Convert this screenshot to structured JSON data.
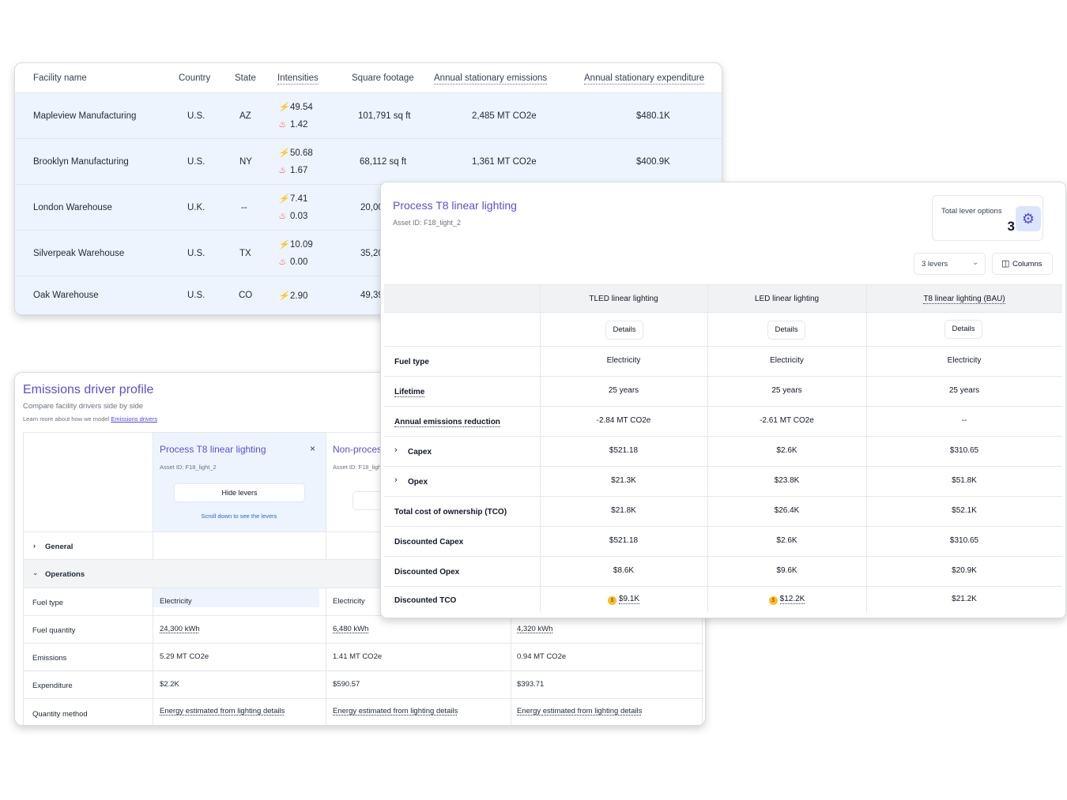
{
  "facility_table": {
    "headers": {
      "facility_name": "Facility name",
      "country": "Country",
      "state": "State",
      "intensities": "Intensities",
      "square_footage": "Square footage",
      "annual_emissions": "Annual stationary emissions",
      "annual_expenditure": "Annual stationary expenditure"
    },
    "rows": [
      {
        "name": "Mapleview Manufacturing",
        "country": "U.S.",
        "state": "AZ",
        "electric": "49.54",
        "fuel": "1.42",
        "sqft": "101,791 sq ft",
        "emissions": "2,485 MT CO2e",
        "expenditure": "$480.1K"
      },
      {
        "name": "Brooklyn Manufacturing",
        "country": "U.S.",
        "state": "NY",
        "electric": "50.68",
        "fuel": "1.67",
        "sqft": "68,112 sq ft",
        "emissions": "1,361 MT CO2e",
        "expenditure": "$400.9K"
      },
      {
        "name": "London Warehouse",
        "country": "U.K.",
        "state": "--",
        "electric": "7.41",
        "fuel": "0.03",
        "sqft": "20,00",
        "emissions": "",
        "expenditure": ""
      },
      {
        "name": "Silverpeak Warehouse",
        "country": "U.S.",
        "state": "TX",
        "electric": "10.09",
        "fuel": "0.00",
        "sqft": "35,20",
        "emissions": "",
        "expenditure": ""
      },
      {
        "name": "Oak Warehouse",
        "country": "U.S.",
        "state": "CO",
        "electric": "2.90",
        "fuel": "",
        "sqft": "49,39",
        "emissions": "",
        "expenditure": ""
      }
    ]
  },
  "profile": {
    "title": "Emissions driver profile",
    "subtitle": "Compare facility drivers side by side",
    "learn_prefix": "Learn more about how we model ",
    "learn_link": "Emissions drivers",
    "col1": {
      "title": "Process T8 linear lighting",
      "asset": "Asset ID: F18_light_2",
      "hide_levers": "Hide levers",
      "scroll_hint": "Scroll down to see the levers",
      "close": "×"
    },
    "col2": {
      "title": "Non-proces",
      "asset": "Asset ID: F18_ligh"
    },
    "sections": {
      "general": "General",
      "operations": "Operations"
    },
    "rows": [
      {
        "label": "Fuel type",
        "c1": "Electricity",
        "c2": "Electricity",
        "c3": ""
      },
      {
        "label": "Fuel quantity",
        "c1": "24,300 kWh",
        "c2": "6,480 kWh",
        "c3": "4,320 kWh"
      },
      {
        "label": "Emissions",
        "c1": "5.29 MT CO2e",
        "c2": "1.41 MT CO2e",
        "c3": "0.94 MT CO2e"
      },
      {
        "label": "Expenditure",
        "c1": "$2.2K",
        "c2": "$590.57",
        "c3": "$393.71"
      },
      {
        "label": "Quantity method",
        "c1": "Energy estimated from lighting details",
        "c2": "Energy estimated from lighting details",
        "c3": "Energy estimated from lighting details"
      }
    ]
  },
  "lever": {
    "title": "Process T8 linear lighting",
    "asset": "Asset ID: F18_light_2",
    "total_label": "Total lever options",
    "total_value": "3",
    "levers_select": "3 levers",
    "columns_button": "Columns",
    "columns": [
      "TLED linear lighting",
      "LED linear lighting",
      "T8 linear lighting (BAU)"
    ],
    "details_label": "Details",
    "rows": [
      {
        "label": "Fuel type",
        "values": [
          "Electricity",
          "Electricity",
          "Electricity"
        ]
      },
      {
        "label": "Lifetime",
        "values": [
          "25 years",
          "25 years",
          "25 years"
        ]
      },
      {
        "label": "Annual emissions reduction",
        "values": [
          "-2.84 MT CO2e",
          "-2.61 MT CO2e",
          "--"
        ]
      },
      {
        "label": "Capex",
        "values": [
          "$521.18",
          "$2.6K",
          "$310.65"
        ]
      },
      {
        "label": "Opex",
        "values": [
          "$21.3K",
          "$23.8K",
          "$51.8K"
        ]
      },
      {
        "label": "Total cost of ownership (TCO)",
        "values": [
          "$21.8K",
          "$26.4K",
          "$52.1K"
        ]
      },
      {
        "label": "Discounted Capex",
        "values": [
          "$521.18",
          "$2.6K",
          "$310.65"
        ]
      },
      {
        "label": "Discounted Opex",
        "values": [
          "$8.6K",
          "$9.6K",
          "$20.9K"
        ]
      },
      {
        "label": "Discounted TCO",
        "values": [
          "$9.1K",
          "$12.2K",
          "$21.2K"
        ]
      }
    ]
  },
  "colors": {
    "accent": "#5b4fcf",
    "row_highlight": "#eef4fd",
    "bolt": "#f5a524",
    "flame": "#ef4444"
  }
}
